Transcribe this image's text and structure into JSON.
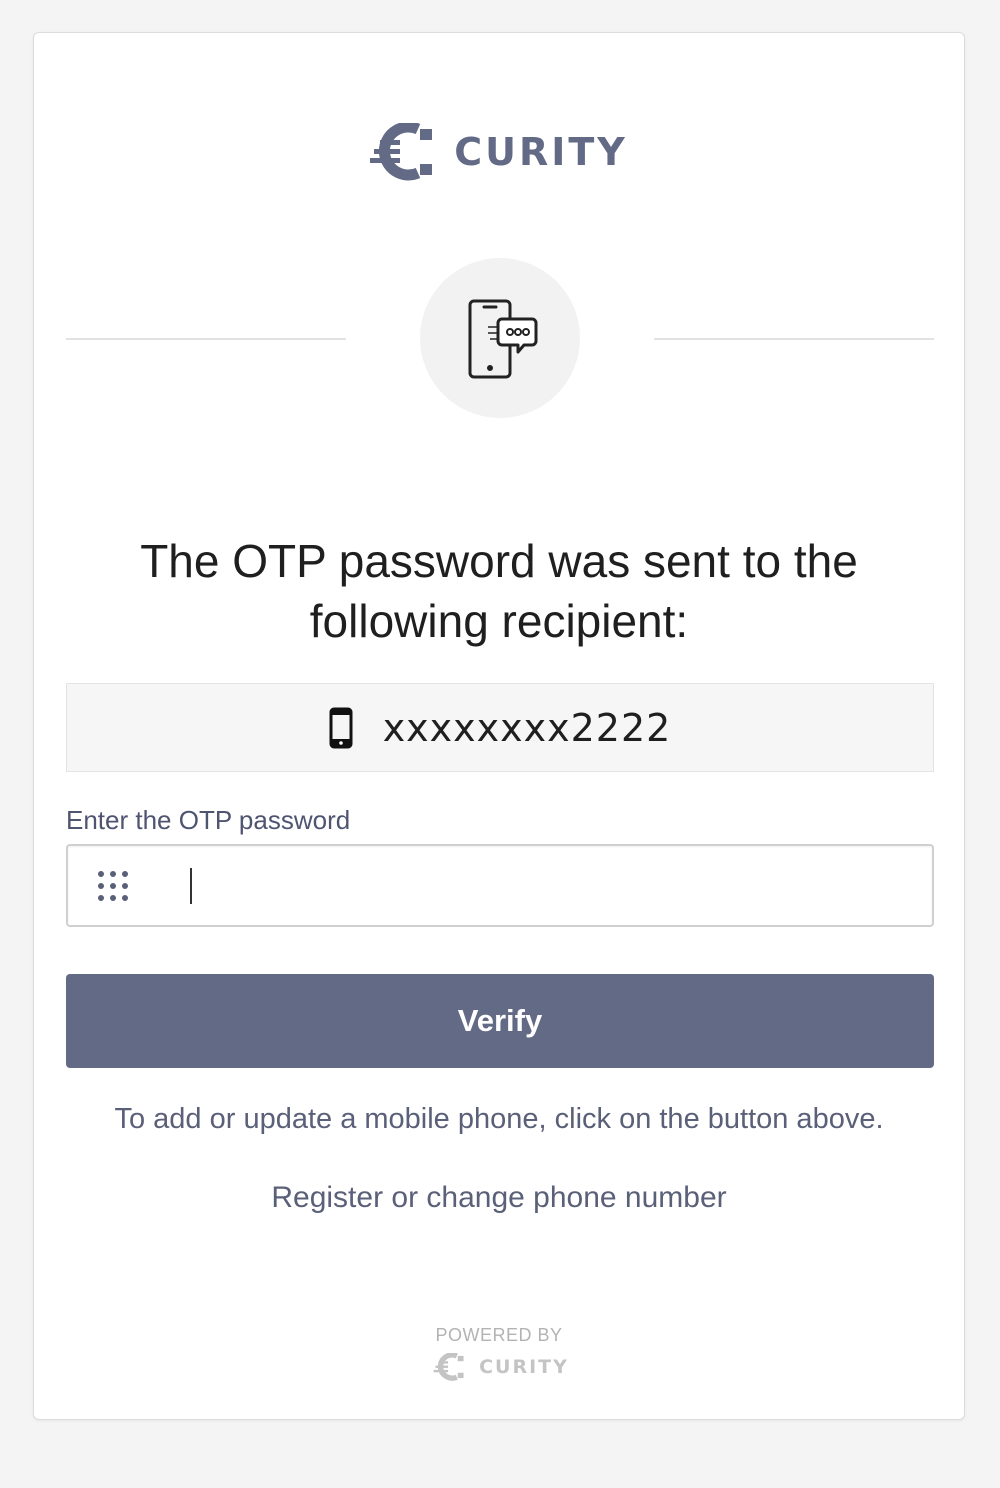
{
  "brand": {
    "name": "CURITY",
    "color": "#626a86"
  },
  "heading": "The OTP password was sent to the following recipient:",
  "recipient": {
    "icon": "mobile-phone-icon",
    "value": "xxxxxxxx2222"
  },
  "otp_field": {
    "label": "Enter the OTP password",
    "icon": "keypad-icon",
    "value": ""
  },
  "verify_button": {
    "label": "Verify"
  },
  "help_text": "To add or update a mobile phone, click on the button above.",
  "register_link": "Register or change phone number",
  "footer": {
    "powered_by": "POWERED BY",
    "brand": "CURITY"
  }
}
